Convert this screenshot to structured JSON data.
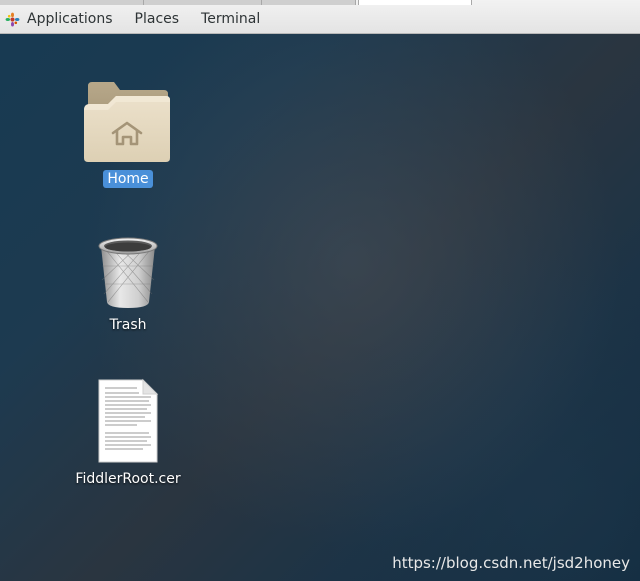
{
  "top_panel": {
    "menus": [
      {
        "label": "Applications"
      },
      {
        "label": "Places"
      },
      {
        "label": "Terminal"
      }
    ],
    "logo_icon": "gnome-foot-icon"
  },
  "desktop": {
    "icons": [
      {
        "label": "Home",
        "icon": "home-folder-icon",
        "selected": true
      },
      {
        "label": "Trash",
        "icon": "trash-icon",
        "selected": false
      },
      {
        "label": "FiddlerRoot.cer",
        "icon": "text-document-icon",
        "selected": false
      }
    ],
    "selection_color": "#4a90d9"
  },
  "watermark": "https://blog.csdn.net/jsd2honey"
}
